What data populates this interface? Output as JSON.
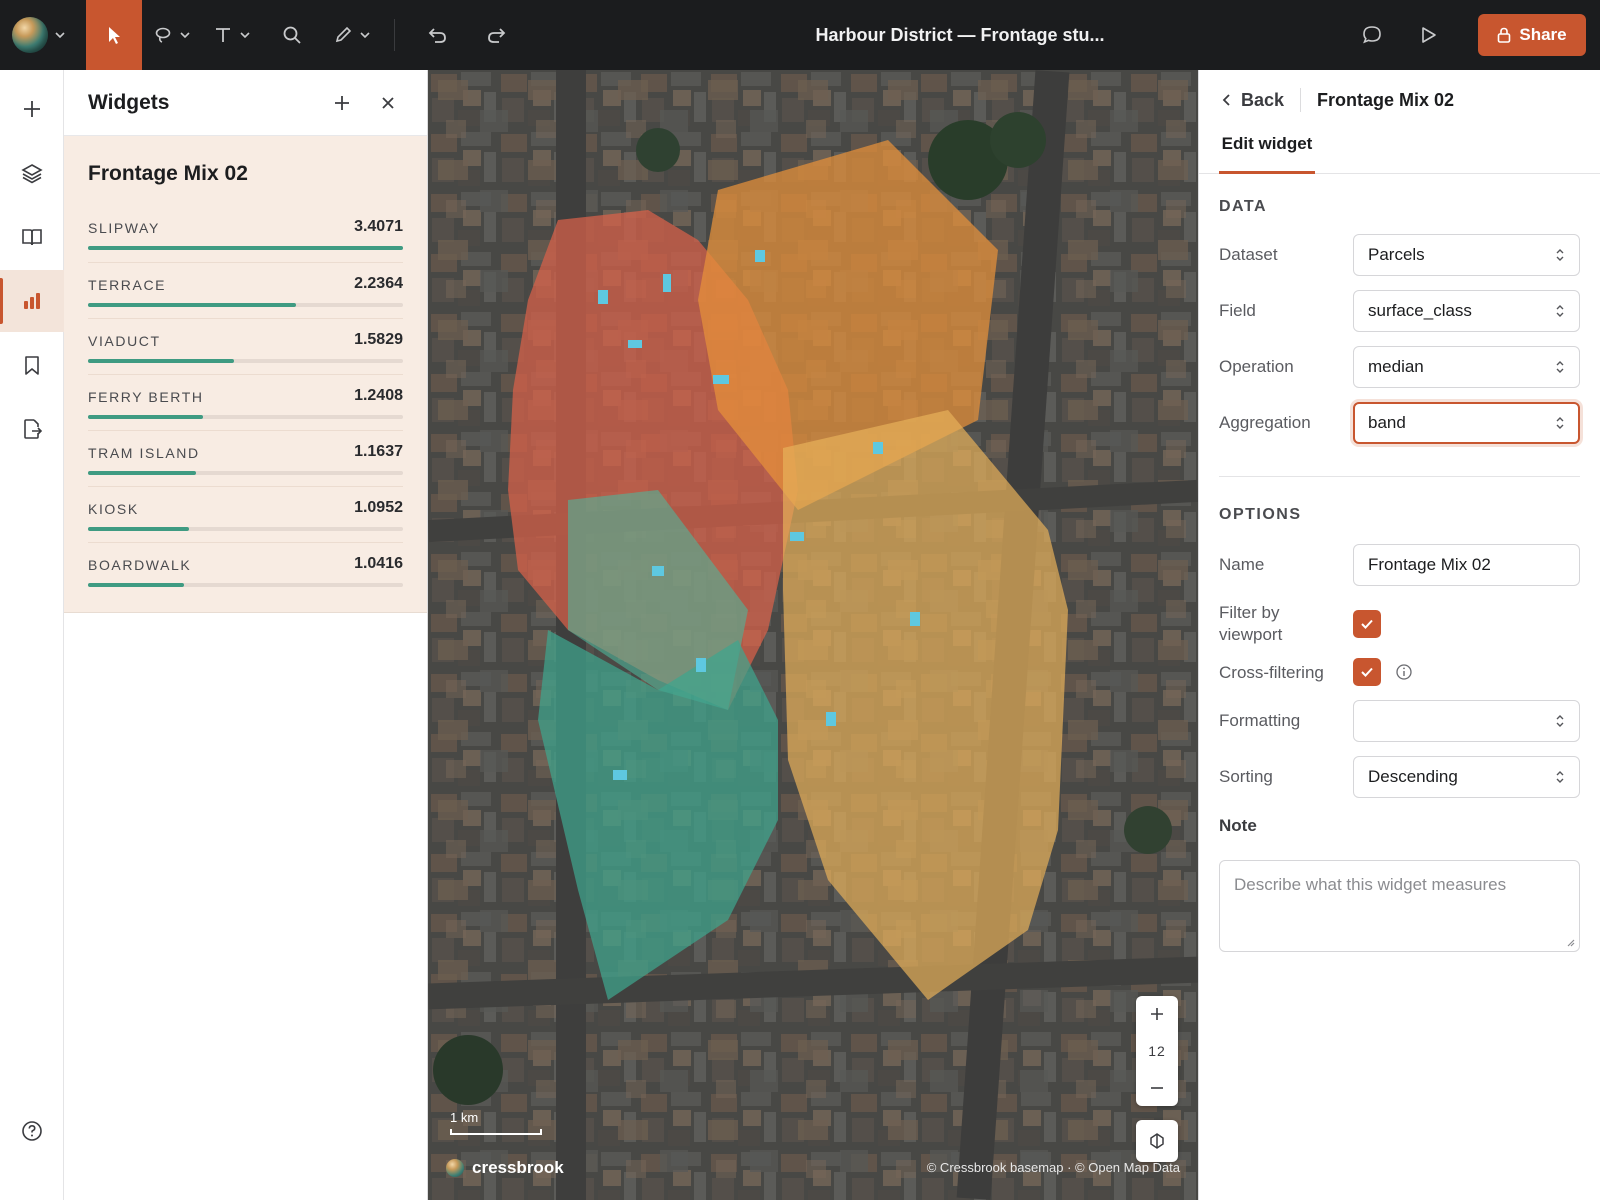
{
  "window": {
    "title": "Harbour District — Frontage stu...",
    "share_label": "Share"
  },
  "toolbar": {
    "tools": [
      "pointer-icon",
      "lasso-icon",
      "text-icon",
      "search-icon",
      "pen-icon",
      "undo-icon",
      "redo-icon"
    ],
    "right_icons": [
      "comment-icon",
      "play-icon",
      "lock-icon"
    ]
  },
  "rail": {
    "items": [
      "plus-icon",
      "layers-icon",
      "book-icon",
      "chart-icon",
      "bookmark-icon",
      "export-icon",
      "help-icon"
    ],
    "active": "chart-icon"
  },
  "widgets_panel": {
    "title": "Widgets",
    "widget": {
      "name": "Frontage Mix 02",
      "categories": [
        {
          "label": "SLIPWAY",
          "value": "3.4071",
          "share": 1.0
        },
        {
          "label": "TERRACE",
          "value": "2.2364",
          "share": 0.66
        },
        {
          "label": "VIADUCT",
          "value": "1.5829",
          "share": 0.465
        },
        {
          "label": "FERRY BERTH",
          "value": "1.2408",
          "share": 0.364
        },
        {
          "label": "TRAM ISLAND",
          "value": "1.1637",
          "share": 0.342
        },
        {
          "label": "KIOSK",
          "value": "1.0952",
          "share": 0.322
        },
        {
          "label": "BOARDWALK",
          "value": "1.0416",
          "share": 0.306
        }
      ]
    }
  },
  "map": {
    "zoom_level": "12",
    "scale_label": "1 km",
    "brand": "cressbrook",
    "attribution": "© Cressbrook basemap · © Open Map Data",
    "zone_colors": [
      "#d9614a",
      "#e8913a",
      "#e7b15a",
      "#3fa58e",
      "#4fb59b"
    ],
    "marker_color": "#5ec8e0"
  },
  "edit_panel": {
    "back_label": "Back",
    "title": "Frontage Mix 02",
    "tab": "Edit widget",
    "data_section": "DATA",
    "fields": {
      "dataset": {
        "label": "Dataset",
        "value": "Parcels"
      },
      "field": {
        "label": "Field",
        "value": "surface_class"
      },
      "operation": {
        "label": "Operation",
        "value": "median"
      },
      "aggregation": {
        "label": "Aggregation",
        "value": "band"
      }
    },
    "options_section": "OPTIONS",
    "options": {
      "name": {
        "label": "Name",
        "value": "Frontage Mix 02"
      },
      "filter_viewport": {
        "label": "Filter by viewport",
        "checked": true
      },
      "cross_filtering": {
        "label": "Cross-filtering",
        "checked": true
      },
      "formatting": {
        "label": "Formatting",
        "value": ""
      },
      "sorting": {
        "label": "Sorting",
        "value": "Descending"
      }
    },
    "note": {
      "label": "Note",
      "placeholder": "Describe what this widget measures"
    }
  },
  "colors": {
    "accent": "#c8562f",
    "bar": "#3f9b82",
    "topbar": "#1b1c1e",
    "card": "#f8ece3"
  }
}
